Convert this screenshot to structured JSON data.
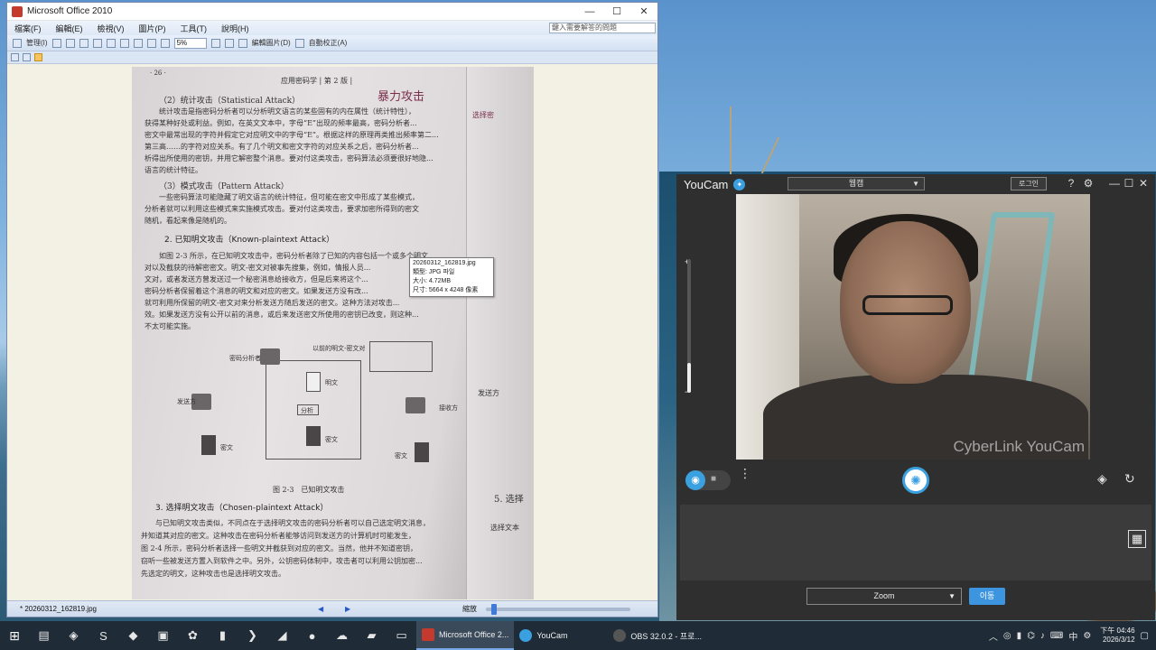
{
  "office": {
    "title": "Microsoft Office 2010",
    "menu": [
      "檔案(F)",
      "編輯(E)",
      "檢視(V)",
      "圖片(P)",
      "工具(T)",
      "說明(H)"
    ],
    "help_placeholder": "鍵入需要解答的問題",
    "toolbar": {
      "organize_label": "管理(I)",
      "zoom_value": "5%",
      "edit_label": "編輯圖片(D)",
      "autocorrect_label": "自動校正(A)"
    },
    "document": {
      "page_header": "· 26 ·",
      "running_title": "应用密码学 | 第 2 版 |",
      "sec_stat": "（2）统计攻击（Statistical Attack）",
      "stat_lines": [
        "统计攻击是指密码分析者可以分析明文语言的某些固有的内在属性（统计特性），",
        "获得某种好处或利益。例如，在英文文本中，字母“E”出现的频率最高，密码分析者...",
        "密文中最常出现的字符并假定它对应明文中的字母“E”。根据这样的原理再类推出频率第二...",
        "第三高……的字符对应关系。有了几个明文和密文字符的对应关系之后，密码分析者...",
        "析得出所使用的密钥，并用它解密整个消息。要对付这类攻击，密码算法必须要很好地隐...",
        "语言的统计特征。"
      ],
      "sec_pattern": "（3）模式攻击（Pattern Attack）",
      "pattern_lines": [
        "一些密码算法可能隐藏了明文语言的统计特征，但可能在密文中形成了某些模式，",
        "分析者就可以利用这些模式来实施模式攻击。要对付这类攻击，要求加密所得到的密文",
        "随机，看起来像是随机的。"
      ],
      "sec_known": "2. 已知明文攻击（Known-plaintext Attack）",
      "known_lines": [
        "如图 2-3 所示，在已知明文攻击中，密码分析者除了已知的内容包括一个或多个明文...",
        "对以及截获的待解密密文。明文-密文对被事先搜集，例如，情报人员...",
        "文对，或者发送方曾发送过一个秘密消息给接收方，但是后来将这个...",
        "密码分析者保留着这个消息的明文和对应的密文。如果发送方没有改...",
        "就可利用所保留的明文-密文对来分析发送方随后发送的密文。这种方法对攻击...",
        "效。如果发送方没有公开以前的消息，或后来发送密文所使用的密钥已改变，则这种...",
        "不太可能实施。"
      ],
      "diagram": {
        "analyst": "密码分析者",
        "prev_pair": "以前的明文-密文对",
        "sender": "发送方",
        "receiver": "接收方",
        "plaintext": "明文",
        "analysis": "分析",
        "ciphertext_a": "密文",
        "ciphertext_b": "密文",
        "ciphertext_c": "密文",
        "caption": "图 2-3　已知明文攻击"
      },
      "sec_chosen": "3. 选择明文攻击（Chosen-plaintext Attack）",
      "chosen_lines": [
        "与已知明文攻击类似，不同点在于选择明文攻击的密码分析者可以自己选定明文消息，",
        "并知道其对应的密文。这种攻击在密码分析者能够访问到发送方的计算机时可能发生，",
        "图 2-4 所示，密码分析者选择一些明文并截获到对应的密文。当然，他并不知道密钥，",
        "窃听一些被发送方置入到软件之中。另外，公钥密码体制中，攻击者可以利用公钥加密...",
        "先选定的明文，这种攻击也是选择明文攻击。"
      ],
      "margin_handwriting": "暴力攻击",
      "right_page": {
        "send_label": "发送方",
        "sec5": "5. 选择",
        "choose": "选择文本",
        "sec_known_head": "选择密"
      }
    },
    "tooltip": {
      "filename": "20260312_162819.jpg",
      "type": "類型: JPG 파일",
      "size": "大小: 4.72MB",
      "dimensions": "尺寸: 5664 x 4248 像素"
    },
    "status": {
      "filename": "* 20260312_162819.jpg",
      "prev": "◀",
      "next": "▶",
      "zoom_label": "縮放"
    }
  },
  "youcam": {
    "title": "YouCam",
    "source_select": "웹캠",
    "login": "로그인",
    "watermark": "CyberLink YouCam",
    "effect_select": "Zoom",
    "apply_button": "이동",
    "zoom_level": 0.22
  },
  "taskbar": {
    "apps": [
      {
        "label": "Microsoft Office 2...",
        "color": "#c43a2c",
        "active": true
      },
      {
        "label": "YouCam",
        "color": "#3aa0e0",
        "active": false
      },
      {
        "label": "OBS 32.0.2 - 프로...",
        "color": "#555555",
        "active": false
      }
    ],
    "ime": "中",
    "time": "下午 04:46",
    "date": "2026/3/12"
  }
}
